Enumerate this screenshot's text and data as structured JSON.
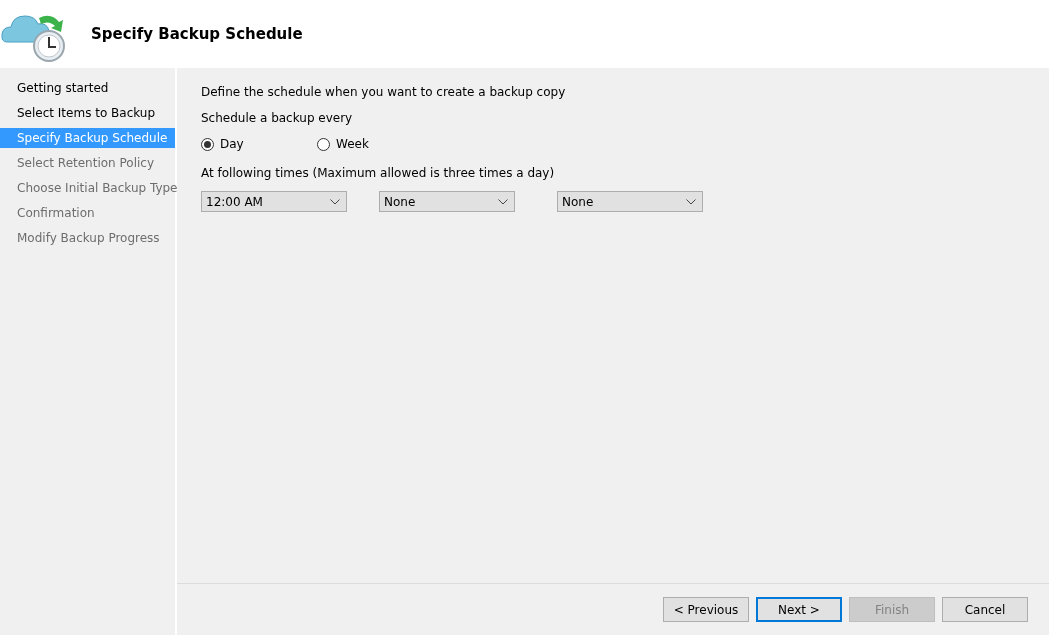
{
  "header": {
    "title": "Specify Backup Schedule"
  },
  "steps": [
    {
      "label": "Getting started",
      "selected": false,
      "disabled": false
    },
    {
      "label": "Select Items to Backup",
      "selected": false,
      "disabled": false
    },
    {
      "label": "Specify Backup Schedule",
      "selected": true,
      "disabled": false
    },
    {
      "label": "Select Retention Policy",
      "selected": false,
      "disabled": true
    },
    {
      "label": "Choose Initial Backup Type",
      "selected": false,
      "disabled": true
    },
    {
      "label": "Confirmation",
      "selected": false,
      "disabled": true
    },
    {
      "label": "Modify Backup Progress",
      "selected": false,
      "disabled": true
    }
  ],
  "intro": "Define the schedule when you want to create a backup copy",
  "frequency_label": "Schedule a backup every",
  "frequency_options": [
    {
      "label": "Day",
      "selected": true
    },
    {
      "label": "Week",
      "selected": false
    }
  ],
  "times_label": "At following times (Maximum allowed is three times a day)",
  "time_dropdowns": [
    "12:00 AM",
    "None",
    "None"
  ],
  "buttons": [
    {
      "label": "< Previous",
      "default": false,
      "disabled": false
    },
    {
      "label": "Next >",
      "default": true,
      "disabled": false
    },
    {
      "label": "Finish",
      "default": false,
      "disabled": true
    },
    {
      "label": "Cancel",
      "default": false,
      "disabled": false
    }
  ]
}
